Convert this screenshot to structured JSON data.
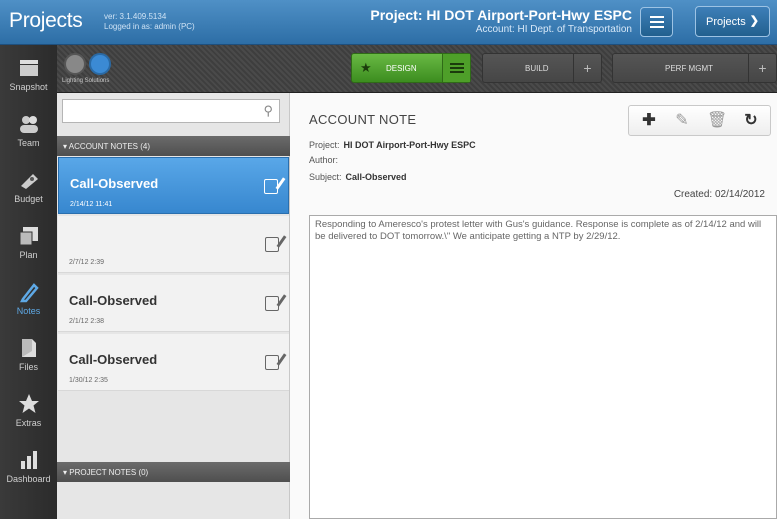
{
  "app": {
    "logo": "Projects",
    "version": "ver: 3.1.409.5134",
    "logged_in": "Logged in as: admin (PC)"
  },
  "project": {
    "title": "Project: HI DOT Airport-Port-Hwy ESPC",
    "account": "Account: HI Dept. of Transportation"
  },
  "header": {
    "projects_dropdown": "Projects"
  },
  "sidebar": {
    "items": [
      {
        "label": "Snapshot",
        "icon": "snapshot-icon"
      },
      {
        "label": "Team",
        "icon": "team-icon"
      },
      {
        "label": "Budget",
        "icon": "budget-icon"
      },
      {
        "label": "Plan",
        "icon": "plan-icon"
      },
      {
        "label": "Notes",
        "icon": "notes-icon",
        "active": true
      },
      {
        "label": "Files",
        "icon": "files-icon"
      },
      {
        "label": "Extras",
        "icon": "star-icon"
      },
      {
        "label": "Dashboard",
        "icon": "dashboard-icon"
      }
    ]
  },
  "toolbar": {
    "tool_label": "Lighting Solutions",
    "phases": {
      "design": "DESIGN",
      "build": "BUILD",
      "perf": "PERF MGMT"
    },
    "plus": "+"
  },
  "notes_list": {
    "search_placeholder": "",
    "account_header": "ACCOUNT NOTES (4)",
    "project_header": "PROJECT NOTES (0)",
    "items": [
      {
        "title": "Call-Observed",
        "date": "2/14/12 11:41"
      },
      {
        "title": "",
        "date": "2/7/12 2:39"
      },
      {
        "title": "Call-Observed",
        "date": "2/1/12 2:38"
      },
      {
        "title": "Call-Observed",
        "date": "1/30/12 2:35"
      }
    ]
  },
  "detail": {
    "heading": "ACCOUNT NOTE",
    "project_label": "Project:",
    "project_value": "HI DOT Airport-Port-Hwy ESPC",
    "author_label": "Author:",
    "author_value": "",
    "subject_label": "Subject:",
    "subject_value": "Call-Observed",
    "created": "Created: 02/14/2012",
    "body": "Responding to Ameresco's protest letter with Gus's guidance. Response is complete as of 2/14/12 and will be delivered to DOT tomorrow.\\\" We anticipate getting a NTP by 2/29/12."
  },
  "colors": {
    "header_blue": "#3f80b8",
    "active_green": "#5aad36",
    "selected_blue": "#4898db",
    "sidebar_dark": "#333333"
  }
}
